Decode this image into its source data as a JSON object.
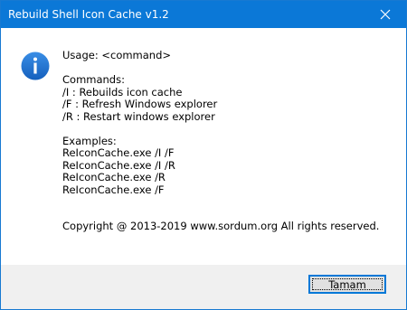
{
  "window": {
    "title": "Rebuild Shell Icon Cache v1.2",
    "close_icon": "close-icon",
    "accent_color": "#0b78d7"
  },
  "message": {
    "icon": "info-icon",
    "icon_color": "#1c6fcf",
    "usage": "Usage: <command>",
    "commands_header": "Commands:",
    "commands": [
      "/I : Rebuilds icon cache",
      "/F : Refresh Windows explorer",
      "/R : Restart windows explorer"
    ],
    "examples_header": "Examples:",
    "examples": [
      "ReIconCache.exe /I /F",
      "ReIconCache.exe /I /R",
      "ReIconCache.exe /R",
      "ReIconCache.exe /F"
    ],
    "copyright": "Copyright @ 2013-2019 www.sordum.org All rights reserved."
  },
  "buttons": {
    "ok_label": "Tamam"
  }
}
